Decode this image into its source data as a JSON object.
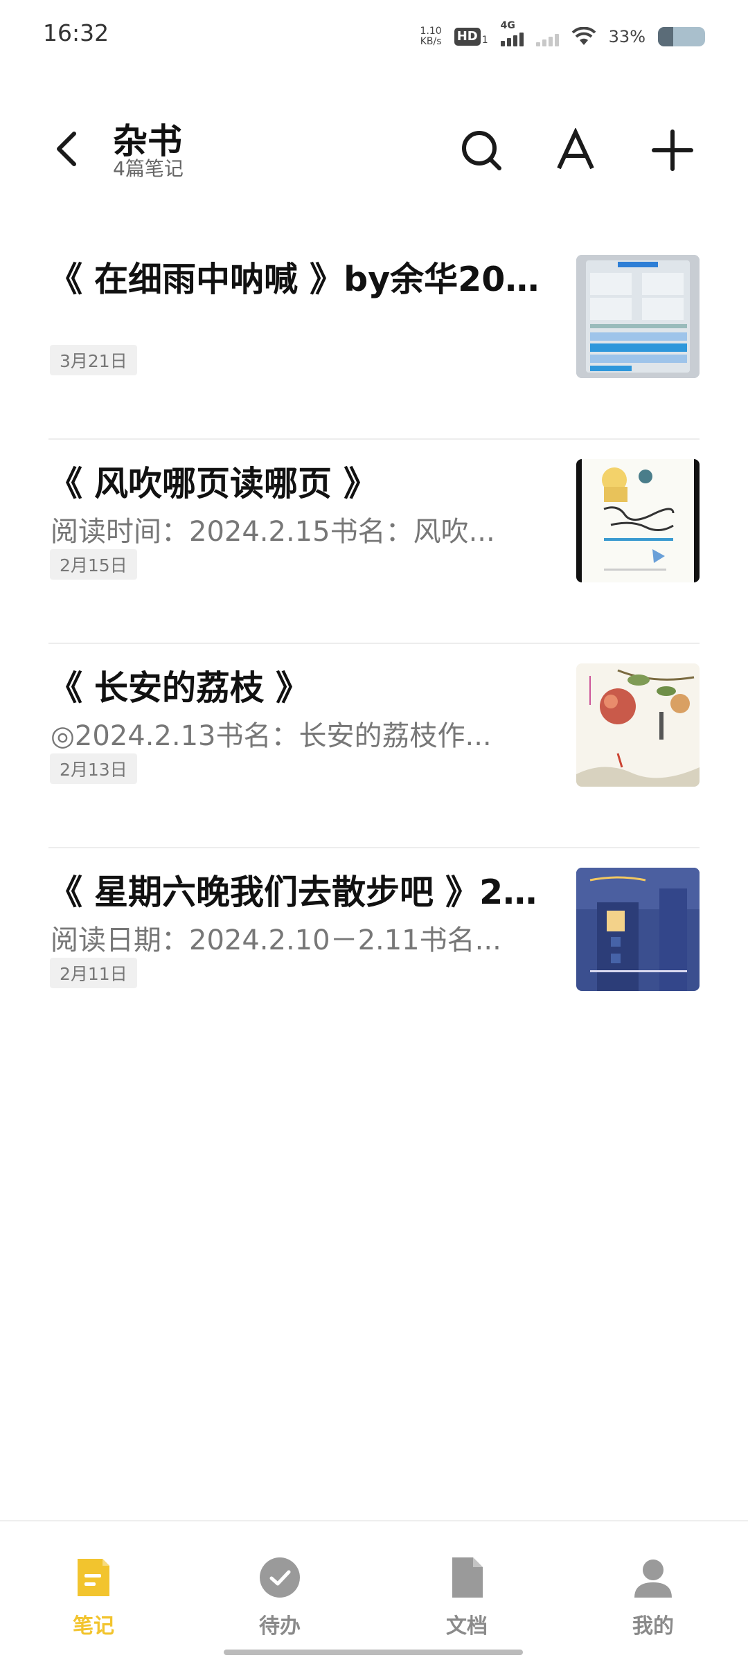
{
  "status_bar": {
    "time": "16:32",
    "net_speed_value": "1.10",
    "net_speed_unit": "KB/s",
    "hd_label": "HD",
    "hd_sub": "1",
    "network_label": "4G",
    "battery_percent": "33%"
  },
  "header": {
    "title": "杂书",
    "subtitle": "4篇笔记"
  },
  "notes": [
    {
      "title": "《 在细雨中呐喊 》by余华202...",
      "snippet": "",
      "date": "3月21日",
      "thumb": "reading-stats-screenshot"
    },
    {
      "title": "《 风吹哪页读哪页 》",
      "snippet": "阅读时间：2024.2.15书名：风吹...",
      "date": "2月15日",
      "thumb": "book-cover-wind"
    },
    {
      "title": "《 长安的荔枝 》",
      "snippet": "◎2024.2.13书名：长安的荔枝作...",
      "date": "2月13日",
      "thumb": "book-cover-lychee"
    },
    {
      "title": "《 星期六晚我们去散步吧 》2...",
      "snippet": "阅读日期：2024.2.10－2.11书名...",
      "date": "2月11日",
      "thumb": "book-cover-night-walk"
    }
  ],
  "bottom_nav": [
    {
      "label": "笔记",
      "icon": "note-icon",
      "active": true
    },
    {
      "label": "待办",
      "icon": "check-circle-icon",
      "active": false
    },
    {
      "label": "文档",
      "icon": "document-icon",
      "active": false
    },
    {
      "label": "我的",
      "icon": "person-icon",
      "active": false
    }
  ],
  "colors": {
    "accent": "#f2c42e",
    "inactive": "#8a8a8a"
  }
}
